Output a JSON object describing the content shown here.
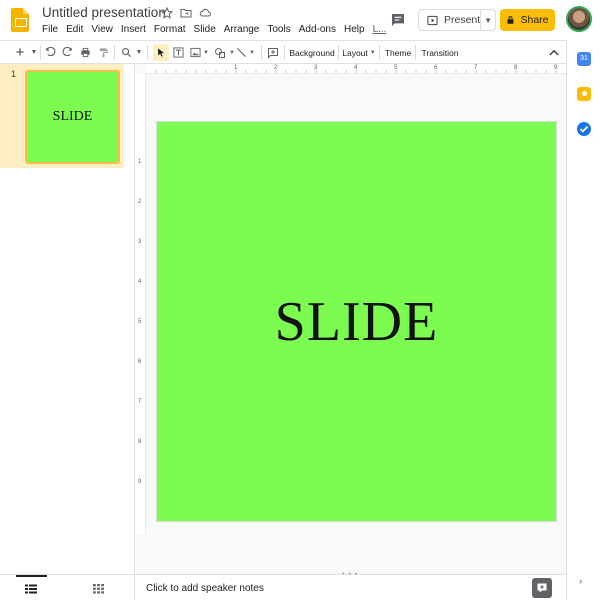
{
  "header": {
    "doc_title": "Untitled presentation",
    "menu": [
      "File",
      "Edit",
      "View",
      "Insert",
      "Format",
      "Slide",
      "Arrange",
      "Tools",
      "Add-ons",
      "Help",
      "L..."
    ],
    "present_label": "Present",
    "share_label": "Share"
  },
  "toolbar": {
    "background_label": "Background",
    "layout_label": "Layout",
    "theme_label": "Theme",
    "transition_label": "Transition"
  },
  "ruler": {
    "h_labels": [
      "1",
      "2",
      "3",
      "4",
      "5",
      "6",
      "7",
      "8",
      "9"
    ],
    "v_labels": [
      "1",
      "2",
      "3",
      "4",
      "5",
      "6",
      "7",
      "8",
      "9"
    ]
  },
  "filmstrip": {
    "slides": [
      {
        "number": "1",
        "text": "SLIDE"
      }
    ]
  },
  "slide": {
    "text": "SLIDE",
    "background_color": "#7cfc50"
  },
  "notes": {
    "placeholder": "Click to add speaker notes"
  },
  "colors": {
    "accent_share": "#fbbc04",
    "selection_fill": "#fdefc3",
    "selection_border": "#f6c143"
  },
  "icons": {
    "side_panel": [
      "calendar-icon",
      "keep-icon",
      "tasks-icon"
    ]
  }
}
